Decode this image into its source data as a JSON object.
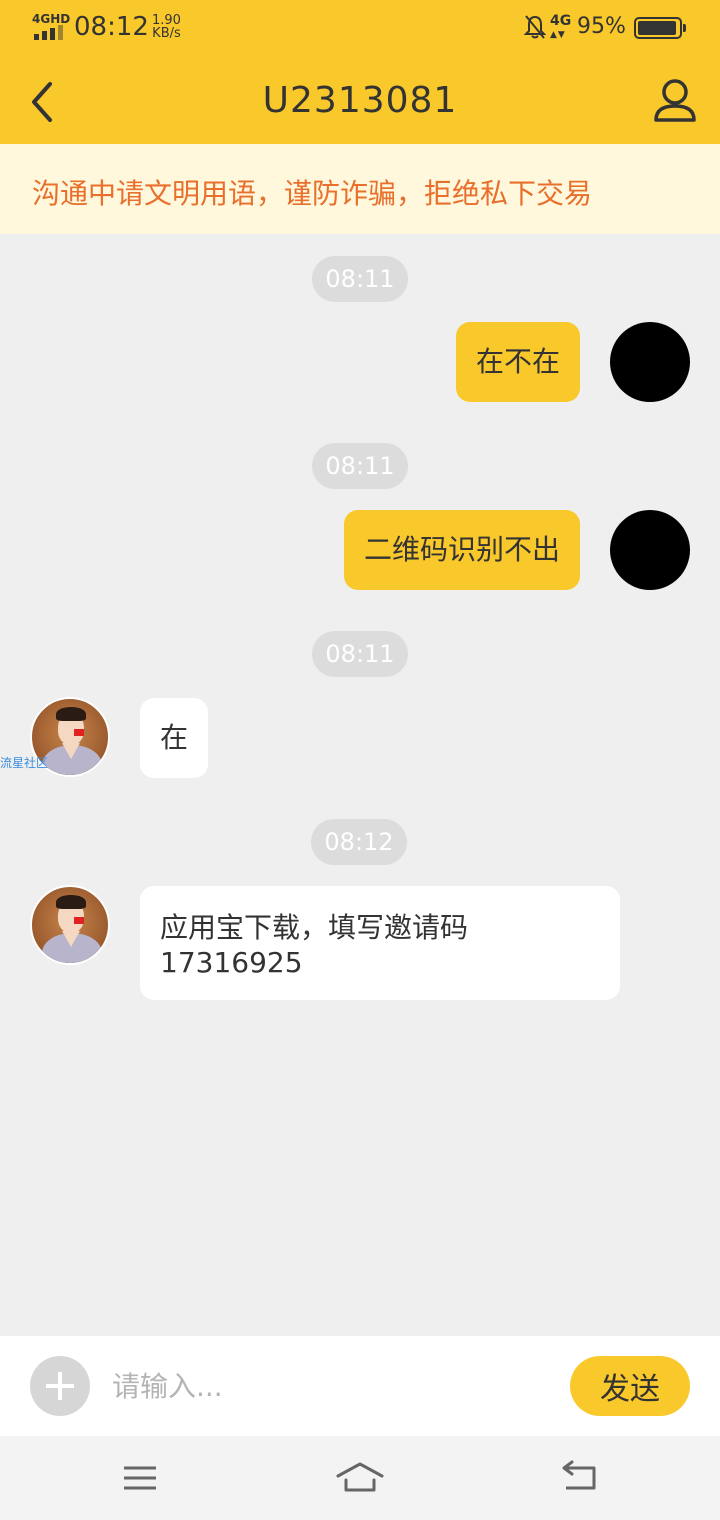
{
  "status_bar": {
    "network_type": "4GHD",
    "time": "08:12",
    "speed_value": "1.90",
    "speed_unit": "KB/s",
    "mobile_data": "4G",
    "battery_percent": "95%",
    "battery_level": 0.95,
    "icons": [
      "signal-icon",
      "bell-off-icon",
      "data-arrows-icon",
      "battery-icon"
    ]
  },
  "header": {
    "title": "U2313081",
    "icons": [
      "back-arrow-icon",
      "user-profile-icon"
    ]
  },
  "notice": {
    "text": "沟通中请文明用语，谨防诈骗，拒绝私下交易"
  },
  "messages": [
    {
      "timestamp": "08:11",
      "from": "me",
      "text": "在不在"
    },
    {
      "timestamp": "08:11",
      "from": "me",
      "text": "二维码识别不出"
    },
    {
      "timestamp": "08:11",
      "from": "other",
      "text": "在",
      "watermark": "流星社区"
    },
    {
      "timestamp": "08:12",
      "from": "other",
      "text": "应用宝下载，填写邀请码",
      "text2": "17316925"
    }
  ],
  "input_bar": {
    "placeholder": "请输入...",
    "send_label": "发送",
    "icons": [
      "plus-icon"
    ]
  },
  "nav_bar": {
    "icons": [
      "menu-icon",
      "home-icon",
      "back-icon"
    ]
  },
  "colors": {
    "accent": "#f9c82b",
    "notice_bg": "#fff8dc",
    "notice_text": "#e8702c",
    "chat_bg": "#efefef"
  }
}
